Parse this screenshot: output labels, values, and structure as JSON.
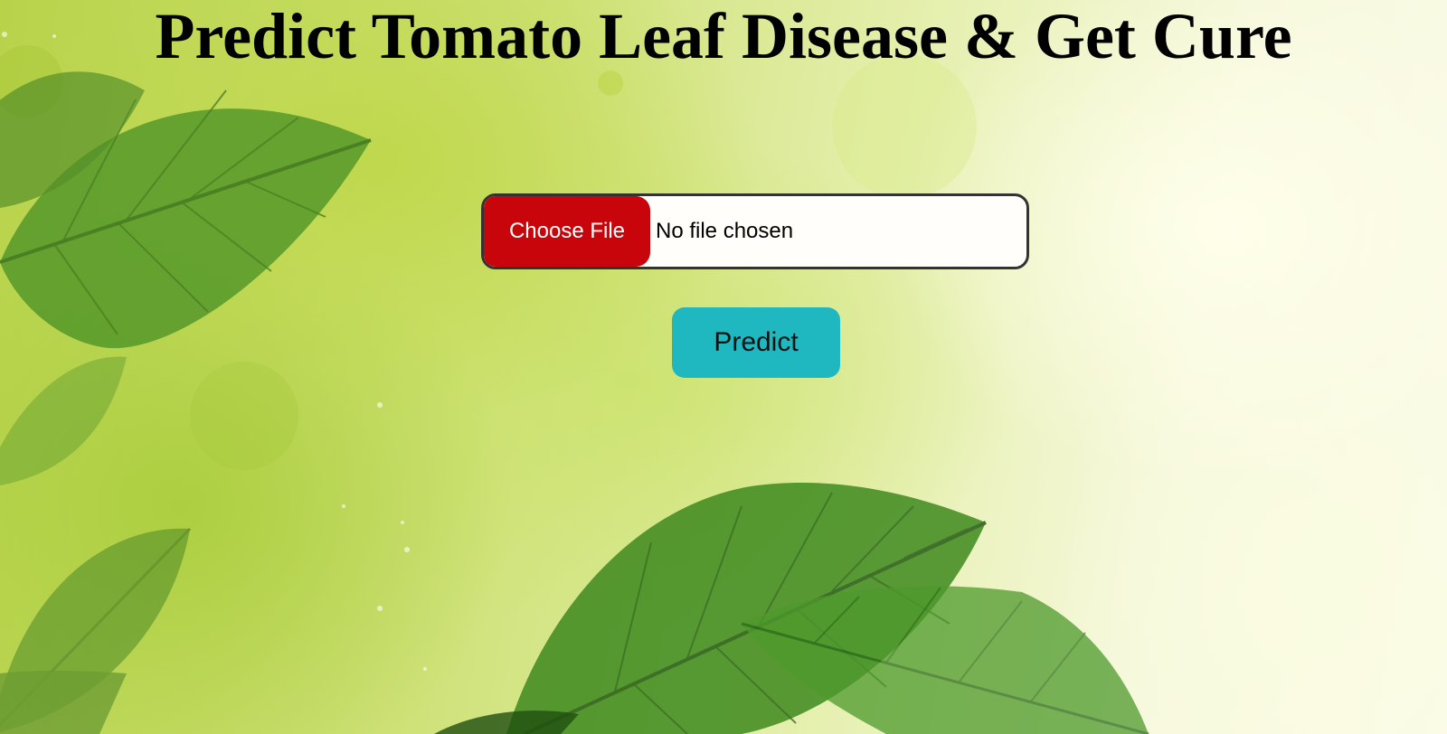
{
  "header": {
    "title": "Predict Tomato Leaf Disease & Get Cure"
  },
  "upload": {
    "choose_label": "Choose File",
    "status": "No file chosen"
  },
  "actions": {
    "predict_label": "Predict"
  },
  "colors": {
    "choose_button": "#c8050a",
    "predict_button": "#1fb8c1",
    "leaf_dark": "#3f8a1f",
    "leaf_light": "#7fb83a"
  },
  "background": {
    "icon": "leaves-background-image"
  }
}
